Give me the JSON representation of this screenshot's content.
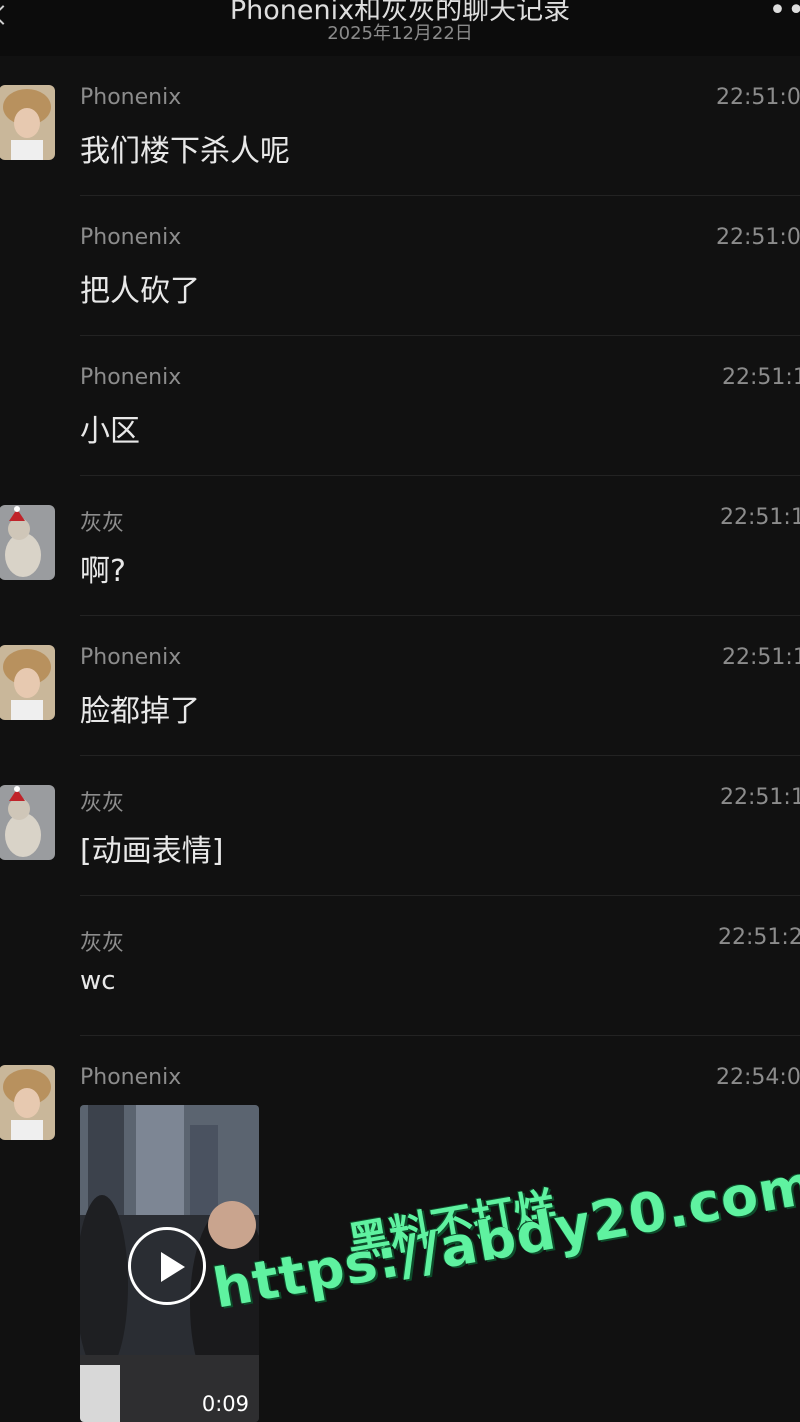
{
  "header": {
    "title": "Phonenix和灰灰的聊天记录",
    "date": "2025年12月22日"
  },
  "messages": [
    {
      "sender": "Phonenix",
      "time": "22:51:0",
      "text": "我们楼下杀人呢",
      "avatar": "phonenix"
    },
    {
      "sender": "Phonenix",
      "time": "22:51:0",
      "text": "把人砍了",
      "avatar": ""
    },
    {
      "sender": "Phonenix",
      "time": "22:51:1",
      "text": "小区",
      "avatar": ""
    },
    {
      "sender": "灰灰",
      "time": "22:51:1",
      "text": "啊?",
      "avatar": "huihui"
    },
    {
      "sender": "Phonenix",
      "time": "22:51:1",
      "text": "脸都掉了",
      "avatar": "phonenix"
    },
    {
      "sender": "灰灰",
      "time": "22:51:1",
      "text": "[动画表情]",
      "avatar": "huihui"
    },
    {
      "sender": "灰灰",
      "time": "22:51:2",
      "text": "wc",
      "avatar": ""
    },
    {
      "sender": "Phonenix",
      "time": "22:54:0",
      "text": "",
      "avatar": "phonenix"
    }
  ],
  "video": {
    "duration": "0:09"
  },
  "watermark": {
    "line1": "黑料不打烊",
    "line2": "https://abdy20.com"
  },
  "colors": {
    "background": "#111111",
    "watermark": "#5ff2a0"
  }
}
